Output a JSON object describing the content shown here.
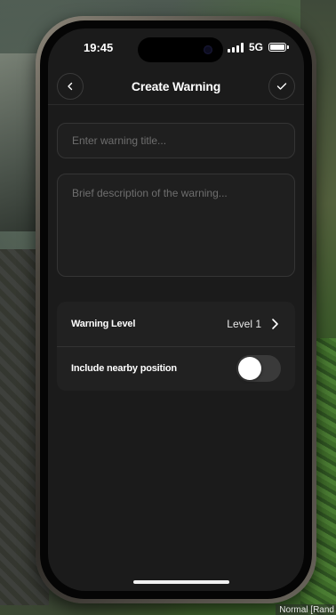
{
  "status_bar": {
    "time": "19:45",
    "network": "5G",
    "signal_bars": 4,
    "battery_level": 1.0
  },
  "nav": {
    "title": "Create Warning",
    "back_icon": "chevron-left-icon",
    "confirm_icon": "checkmark-icon"
  },
  "form": {
    "title_placeholder": "Enter warning title...",
    "title_value": "",
    "description_placeholder": "Brief description of the warning...",
    "description_value": ""
  },
  "settings": {
    "level_label": "Warning Level",
    "level_value": "Level 1",
    "position_label": "Include nearby position",
    "position_enabled": false
  },
  "overlay": {
    "corner_text": "Normal [Rand"
  },
  "colors": {
    "screen_bg": "#1b1b1b",
    "field_bg": "#1f1f1f",
    "card_bg": "#212121",
    "toggle_off": "#3a3a3a",
    "text_primary": "#ffffff",
    "placeholder": "#6e6e6e"
  }
}
